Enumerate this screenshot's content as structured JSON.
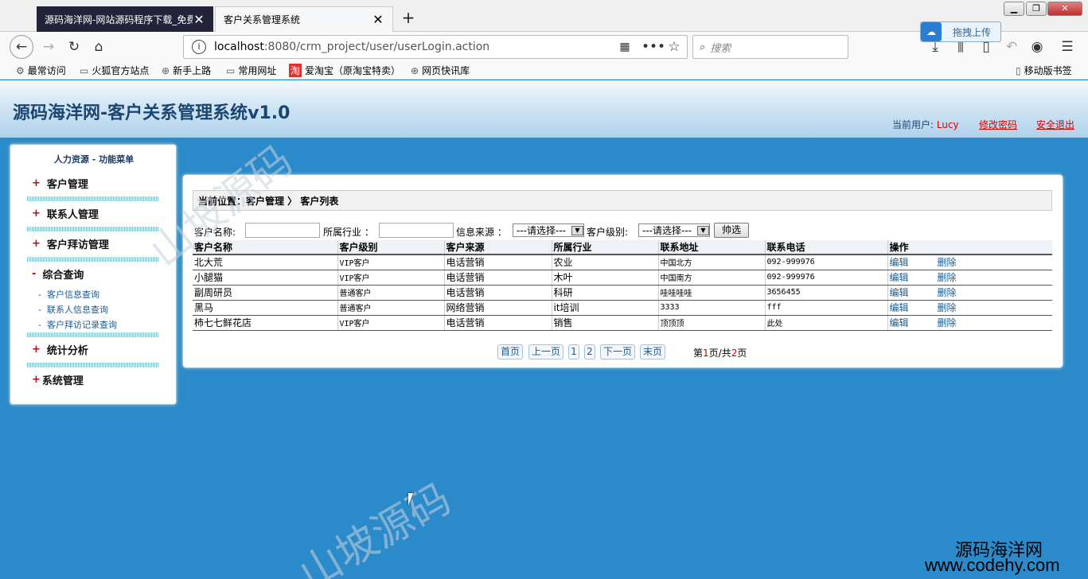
{
  "browser": {
    "tabs": [
      {
        "title": "源码海洋网-网站源码程序下载_免费",
        "close": "✕"
      },
      {
        "title": "客户关系管理系统",
        "close": "✕"
      }
    ],
    "new_tab": "+",
    "url_host": "localhost",
    "url_rest": ":8080/crm_project/user/userLogin.action",
    "search_placeholder": "搜索",
    "upload_label": "拖拽上传",
    "bookmarks": [
      "最常访问",
      "火狐官方站点",
      "新手上路",
      "常用网址",
      "爱淘宝（原淘宝特卖）",
      "网页快讯库"
    ],
    "mobile_bookmarks": "移动版书签"
  },
  "app": {
    "title": "源码海洋网-客户关系管理系统v1.0",
    "current_user_label": "当前用户:",
    "current_user": "Lucy",
    "change_password": "修改密码",
    "logout": "安全退出"
  },
  "sidebar": {
    "title": "人力资源  - 功能菜单",
    "items": [
      {
        "label": "客户管理",
        "marker": "+"
      },
      {
        "label": "联系人管理",
        "marker": "+"
      },
      {
        "label": "客户拜访管理",
        "marker": "+"
      },
      {
        "label": "综合查询",
        "marker": "-"
      },
      {
        "label": "统计分析",
        "marker": "+"
      },
      {
        "label": "系统管理",
        "marker": "+"
      }
    ],
    "sub_items": [
      "客户信息查询",
      "联系人信息查询",
      "客户拜访记录查询"
    ],
    "sub_marker": "-"
  },
  "main": {
    "breadcrumb": "当前位置：客户管理 〉 客户列表",
    "filters": {
      "name_label": "客户名称:",
      "industry_label": "所属行业 ：",
      "source_label": "信息来源 ：",
      "source_value": "---请选择---",
      "level_label": "客户级别:",
      "level_value": "---请选择---",
      "button": "帅选"
    },
    "table": {
      "headers": [
        "客户名称",
        "客户级别",
        "客户来源",
        "所属行业",
        "联系地址",
        "联系电话",
        "操作"
      ],
      "rows": [
        [
          "北大荒",
          "VIP客户",
          "电话营销",
          "农业",
          "中国北方",
          "092-999976"
        ],
        [
          "小腿猫",
          "VIP客户",
          "电话营销",
          "木叶",
          "中国南方",
          "092-999976"
        ],
        [
          "副周研员",
          "普通客户",
          "电话营销",
          "科研",
          "哇哇哇哇",
          "3656455"
        ],
        [
          "黑马",
          "普通客户",
          "网络营销",
          "it培训",
          "3333",
          "fff"
        ],
        [
          "柿七七鲜花店",
          "VIP客户",
          "电话营销",
          "销售",
          "顶顶顶",
          "此处"
        ]
      ],
      "edit": "编辑",
      "delete": "删除"
    },
    "pager": {
      "first": "首页",
      "prev": "上一页",
      "pages": [
        "1",
        "2"
      ],
      "next": "下一页",
      "last": "末页",
      "info_prefix": "第",
      "current": "1",
      "info_mid": "页/共",
      "total": "2",
      "info_suffix": "页"
    }
  },
  "watermarks": [
    "山坡源码",
    "山坡源码"
  ],
  "branding": {
    "line1": "源码海洋网",
    "line2": "www.codehy.com"
  },
  "icons": [
    "back-icon",
    "forward-icon",
    "reload-icon",
    "home-icon",
    "info-icon",
    "qr-icon",
    "more-icon",
    "star-icon",
    "search-icon",
    "download-icon",
    "library-icon",
    "sidebar-icon",
    "undo-icon",
    "account-icon",
    "menu-icon"
  ]
}
